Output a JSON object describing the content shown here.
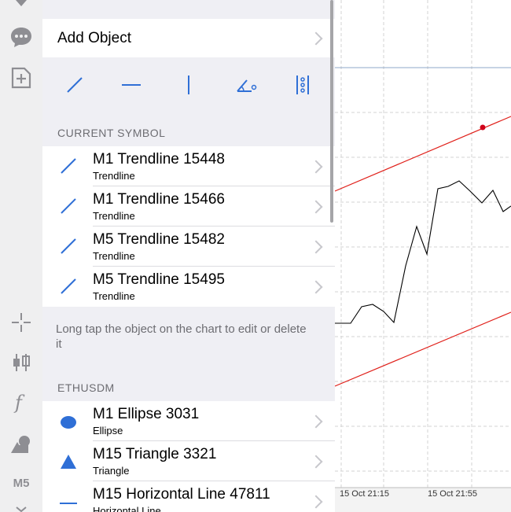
{
  "toolbar": {
    "items": [
      {
        "name": "download-icon"
      },
      {
        "name": "chat-icon"
      },
      {
        "name": "add-page-icon"
      },
      {
        "name": "crosshair-icon"
      },
      {
        "name": "candlestick-icon"
      },
      {
        "name": "function-icon"
      },
      {
        "name": "objects-icon"
      },
      {
        "name": "timeframe-label",
        "label": "M5"
      }
    ]
  },
  "panel": {
    "add_object_label": "Add Object",
    "tools": [
      "trendline-tool-icon",
      "horizontal-line-tool-icon",
      "vertical-line-tool-icon",
      "angle-tool-icon",
      "fibonacci-tool-icon"
    ],
    "current_symbol_header": "CURRENT SYMBOL",
    "current_symbol_items": [
      {
        "title": "M1 Trendline 15448",
        "subtitle": "Trendline",
        "icon": "trendline-icon"
      },
      {
        "title": "M1 Trendline 15466",
        "subtitle": "Trendline",
        "icon": "trendline-icon"
      },
      {
        "title": "M5 Trendline 15482",
        "subtitle": "Trendline",
        "icon": "trendline-icon"
      },
      {
        "title": "M5 Trendline 15495",
        "subtitle": "Trendline",
        "icon": "trendline-icon"
      }
    ],
    "hint": "Long tap the object on the chart to edit or delete it",
    "symbol_header": "ETHUSDM",
    "symbol_items": [
      {
        "title": "M1 Ellipse 3031",
        "subtitle": "Ellipse",
        "icon": "ellipse-icon"
      },
      {
        "title": "M15 Triangle 3321",
        "subtitle": "Triangle",
        "icon": "triangle-icon"
      },
      {
        "title": "M15 Horizontal Line 47811",
        "subtitle": "Horizontal Line",
        "icon": "horizontal-line-icon"
      }
    ]
  },
  "chart": {
    "x_labels": [
      "15 Oct 21:15",
      "15 Oct 21:55"
    ]
  },
  "colors": {
    "accent": "#2f6fd6",
    "trendline": "#e0201a",
    "panel_bg": "#efeff4",
    "toolbar_bg": "#efeff0"
  }
}
